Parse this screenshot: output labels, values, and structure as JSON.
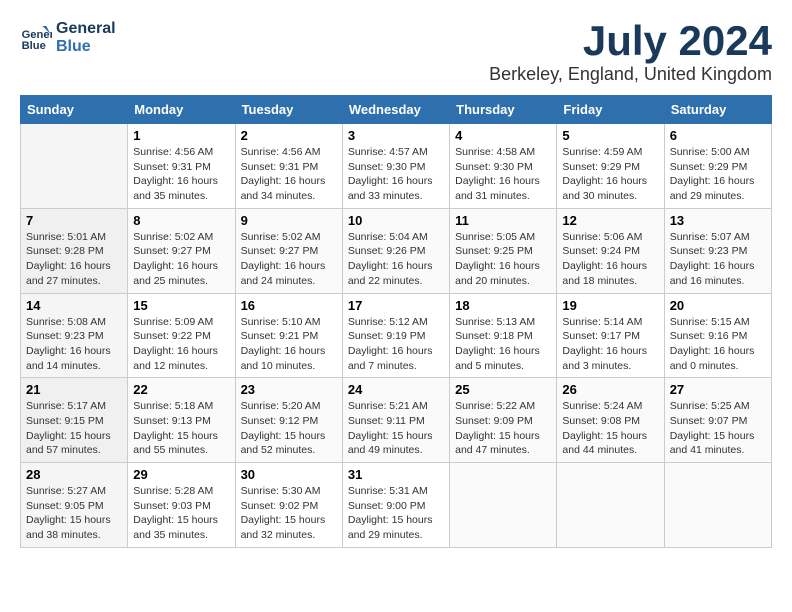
{
  "header": {
    "logo_line1": "General",
    "logo_line2": "Blue",
    "month_year": "July 2024",
    "location": "Berkeley, England, United Kingdom"
  },
  "days_of_week": [
    "Sunday",
    "Monday",
    "Tuesday",
    "Wednesday",
    "Thursday",
    "Friday",
    "Saturday"
  ],
  "weeks": [
    [
      {
        "day": "",
        "info": ""
      },
      {
        "day": "1",
        "info": "Sunrise: 4:56 AM\nSunset: 9:31 PM\nDaylight: 16 hours\nand 35 minutes."
      },
      {
        "day": "2",
        "info": "Sunrise: 4:56 AM\nSunset: 9:31 PM\nDaylight: 16 hours\nand 34 minutes."
      },
      {
        "day": "3",
        "info": "Sunrise: 4:57 AM\nSunset: 9:30 PM\nDaylight: 16 hours\nand 33 minutes."
      },
      {
        "day": "4",
        "info": "Sunrise: 4:58 AM\nSunset: 9:30 PM\nDaylight: 16 hours\nand 31 minutes."
      },
      {
        "day": "5",
        "info": "Sunrise: 4:59 AM\nSunset: 9:29 PM\nDaylight: 16 hours\nand 30 minutes."
      },
      {
        "day": "6",
        "info": "Sunrise: 5:00 AM\nSunset: 9:29 PM\nDaylight: 16 hours\nand 29 minutes."
      }
    ],
    [
      {
        "day": "7",
        "info": "Sunrise: 5:01 AM\nSunset: 9:28 PM\nDaylight: 16 hours\nand 27 minutes."
      },
      {
        "day": "8",
        "info": "Sunrise: 5:02 AM\nSunset: 9:27 PM\nDaylight: 16 hours\nand 25 minutes."
      },
      {
        "day": "9",
        "info": "Sunrise: 5:02 AM\nSunset: 9:27 PM\nDaylight: 16 hours\nand 24 minutes."
      },
      {
        "day": "10",
        "info": "Sunrise: 5:04 AM\nSunset: 9:26 PM\nDaylight: 16 hours\nand 22 minutes."
      },
      {
        "day": "11",
        "info": "Sunrise: 5:05 AM\nSunset: 9:25 PM\nDaylight: 16 hours\nand 20 minutes."
      },
      {
        "day": "12",
        "info": "Sunrise: 5:06 AM\nSunset: 9:24 PM\nDaylight: 16 hours\nand 18 minutes."
      },
      {
        "day": "13",
        "info": "Sunrise: 5:07 AM\nSunset: 9:23 PM\nDaylight: 16 hours\nand 16 minutes."
      }
    ],
    [
      {
        "day": "14",
        "info": "Sunrise: 5:08 AM\nSunset: 9:23 PM\nDaylight: 16 hours\nand 14 minutes."
      },
      {
        "day": "15",
        "info": "Sunrise: 5:09 AM\nSunset: 9:22 PM\nDaylight: 16 hours\nand 12 minutes."
      },
      {
        "day": "16",
        "info": "Sunrise: 5:10 AM\nSunset: 9:21 PM\nDaylight: 16 hours\nand 10 minutes."
      },
      {
        "day": "17",
        "info": "Sunrise: 5:12 AM\nSunset: 9:19 PM\nDaylight: 16 hours\nand 7 minutes."
      },
      {
        "day": "18",
        "info": "Sunrise: 5:13 AM\nSunset: 9:18 PM\nDaylight: 16 hours\nand 5 minutes."
      },
      {
        "day": "19",
        "info": "Sunrise: 5:14 AM\nSunset: 9:17 PM\nDaylight: 16 hours\nand 3 minutes."
      },
      {
        "day": "20",
        "info": "Sunrise: 5:15 AM\nSunset: 9:16 PM\nDaylight: 16 hours\nand 0 minutes."
      }
    ],
    [
      {
        "day": "21",
        "info": "Sunrise: 5:17 AM\nSunset: 9:15 PM\nDaylight: 15 hours\nand 57 minutes."
      },
      {
        "day": "22",
        "info": "Sunrise: 5:18 AM\nSunset: 9:13 PM\nDaylight: 15 hours\nand 55 minutes."
      },
      {
        "day": "23",
        "info": "Sunrise: 5:20 AM\nSunset: 9:12 PM\nDaylight: 15 hours\nand 52 minutes."
      },
      {
        "day": "24",
        "info": "Sunrise: 5:21 AM\nSunset: 9:11 PM\nDaylight: 15 hours\nand 49 minutes."
      },
      {
        "day": "25",
        "info": "Sunrise: 5:22 AM\nSunset: 9:09 PM\nDaylight: 15 hours\nand 47 minutes."
      },
      {
        "day": "26",
        "info": "Sunrise: 5:24 AM\nSunset: 9:08 PM\nDaylight: 15 hours\nand 44 minutes."
      },
      {
        "day": "27",
        "info": "Sunrise: 5:25 AM\nSunset: 9:07 PM\nDaylight: 15 hours\nand 41 minutes."
      }
    ],
    [
      {
        "day": "28",
        "info": "Sunrise: 5:27 AM\nSunset: 9:05 PM\nDaylight: 15 hours\nand 38 minutes."
      },
      {
        "day": "29",
        "info": "Sunrise: 5:28 AM\nSunset: 9:03 PM\nDaylight: 15 hours\nand 35 minutes."
      },
      {
        "day": "30",
        "info": "Sunrise: 5:30 AM\nSunset: 9:02 PM\nDaylight: 15 hours\nand 32 minutes."
      },
      {
        "day": "31",
        "info": "Sunrise: 5:31 AM\nSunset: 9:00 PM\nDaylight: 15 hours\nand 29 minutes."
      },
      {
        "day": "",
        "info": ""
      },
      {
        "day": "",
        "info": ""
      },
      {
        "day": "",
        "info": ""
      }
    ]
  ]
}
